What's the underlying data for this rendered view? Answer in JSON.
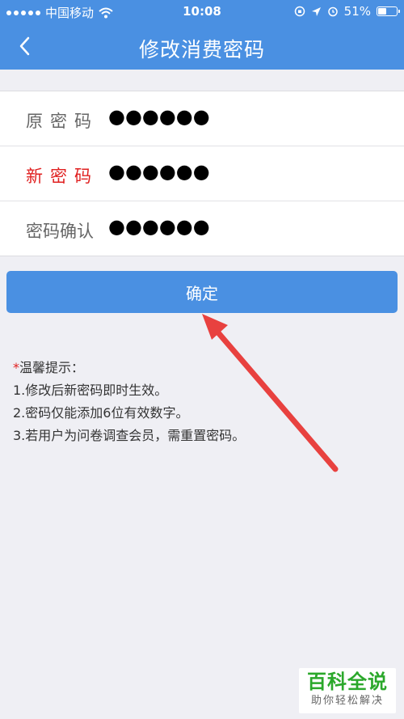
{
  "status_bar": {
    "carrier": "中国移动",
    "time": "10:08",
    "battery": "51%",
    "battery_level": 0.51
  },
  "nav": {
    "title": "修改消费密码",
    "back_icon": "chevron-left-icon"
  },
  "form": {
    "rows": [
      {
        "label": "原密码",
        "value": "●●●●●●",
        "label_color": "#666666"
      },
      {
        "label": "新密码",
        "value": "●●●●●●",
        "label_color": "#e02020"
      },
      {
        "label": "密码确认",
        "value": "●●●●●●",
        "label_color": "#666666"
      }
    ]
  },
  "confirm_button": {
    "label": "确定"
  },
  "tips": {
    "asterisk": "*",
    "title": "温馨提示：",
    "items": [
      "1.修改后新密码即时生效。",
      "2.密码仅能添加6位有效数字。",
      "3.若用户为问卷调查会员，需重置密码。"
    ]
  },
  "watermark": {
    "title": "百科全说",
    "subtitle": "助你轻松解决"
  },
  "colors": {
    "primary": "#4a90e2",
    "background": "#efeff4",
    "highlight_label": "#e02020",
    "annotation_arrow": "#e8413f",
    "watermark_green": "#2ba82b"
  }
}
